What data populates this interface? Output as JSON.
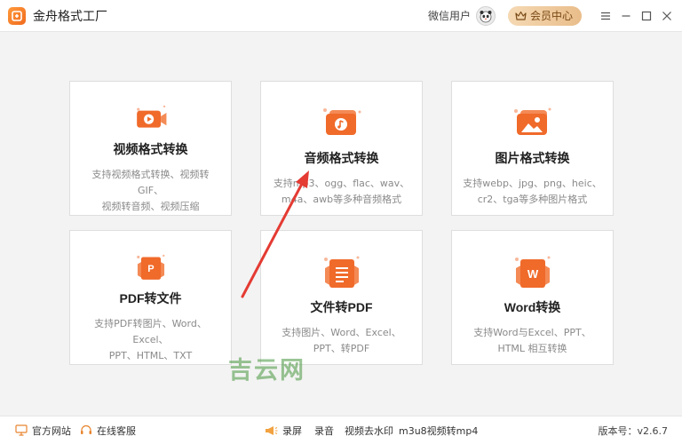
{
  "app": {
    "title": "金舟格式工厂",
    "logo_icon": "logo-icon",
    "brand_color": "#f06a1d"
  },
  "header": {
    "user_label": "微信用户",
    "vip_label": "会员中心",
    "window_controls": [
      "menu-icon",
      "minimize-icon",
      "maximize-icon",
      "close-icon"
    ]
  },
  "cards": [
    {
      "title": "视频格式转换",
      "desc1": "支持视频格式转换、视频转GIF、",
      "desc2": "视频转音频、视频压缩",
      "icon": "video-convert-icon"
    },
    {
      "title": "音频格式转换",
      "desc1": "支持mp3、ogg、flac、wav、",
      "desc2": "m4a、awb等多种音频格式",
      "icon": "audio-convert-icon"
    },
    {
      "title": "图片格式转换",
      "desc1": "支持webp、jpg、png、heic、",
      "desc2": "cr2、tga等多种图片格式",
      "icon": "image-convert-icon"
    },
    {
      "title": "PDF转文件",
      "desc1": "支持PDF转图片、Word、Excel、",
      "desc2": "PPT、HTML、TXT",
      "icon": "pdf-convert-icon"
    },
    {
      "title": "文件转PDF",
      "desc1": "支持图片、Word、Excel、",
      "desc2": "PPT、转PDF",
      "icon": "file-to-pdf-icon"
    },
    {
      "title": "Word转换",
      "desc1": "支持Word与Excel、PPT、",
      "desc2": "HTML 相互转换",
      "icon": "word-convert-icon"
    }
  ],
  "watermark": "吉云网",
  "footer": {
    "website": "官方网站",
    "support": "在线客服",
    "screen_record": "录屏",
    "audio_record": "录音",
    "remove_watermark": "视频去水印",
    "m3u8": "m3u8视频转mp4",
    "version": "版本号：v2.6.7"
  }
}
